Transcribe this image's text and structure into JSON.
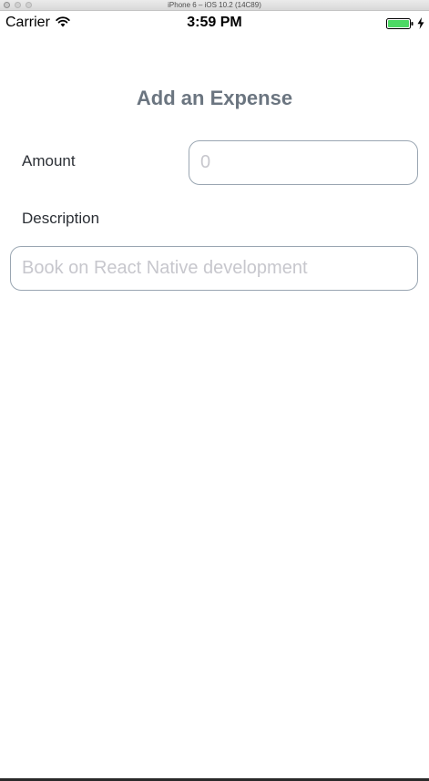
{
  "simulator": {
    "title": "iPhone 6 – iOS 10.2 (14C89)"
  },
  "status_bar": {
    "carrier": "Carrier",
    "time": "3:59 PM",
    "battery_color": "#4cd964"
  },
  "form": {
    "title": "Add an Expense",
    "amount_label": "Amount",
    "amount_placeholder": "0",
    "amount_value": "",
    "description_label": "Description",
    "description_placeholder": "Book on React Native development",
    "description_value": ""
  },
  "colors": {
    "title": "#6b7580",
    "input_border": "#9aa6b2",
    "placeholder": "#c7c7cd"
  }
}
